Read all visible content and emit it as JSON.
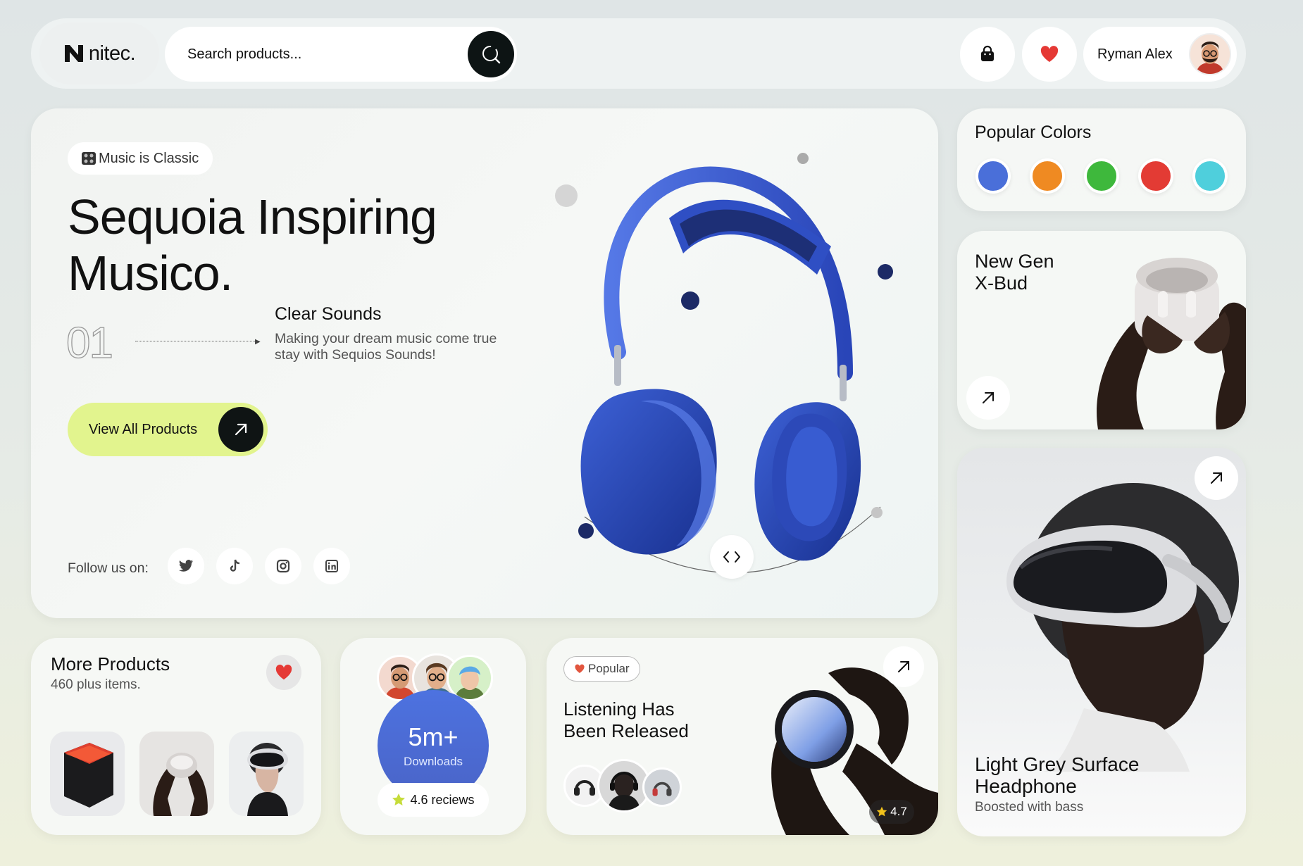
{
  "header": {
    "logo_text": "nitec.",
    "search_placeholder": "Search products...",
    "user_name": "Ryman Alex"
  },
  "hero": {
    "badge": "Music is Classic",
    "title_line1": "Sequoia Inspiring",
    "title_line2": "Musico.",
    "number": "01",
    "feature_title": "Clear Sounds",
    "feature_desc_line1": "Making your dream music come true",
    "feature_desc_line2": "stay with Sequios Sounds!",
    "cta_label": "View All Products",
    "follow_label": "Follow us on:",
    "socials": [
      "twitter-icon",
      "tiktok-icon",
      "instagram-icon",
      "linkedin-icon"
    ]
  },
  "popular_colors": {
    "title": "Popular Colors",
    "colors": [
      "#4a6fd9",
      "#ef8a22",
      "#3eb83c",
      "#e33b34",
      "#4fcfdc"
    ]
  },
  "xbud": {
    "title_line1": "New Gen",
    "title_line2": "X-Bud"
  },
  "vr": {
    "title_line1": "Light Grey Surface",
    "title_line2": "Headphone",
    "subtitle": "Boosted with bass"
  },
  "more_products": {
    "title": "More Products",
    "subtitle": "460 plus items."
  },
  "downloads": {
    "count": "5m+",
    "label": "Downloads",
    "reviews": "4.6 reciews"
  },
  "listening": {
    "badge": "Popular",
    "title_line1": "Listening Has",
    "title_line2": "Been Released",
    "rating": "4.7"
  },
  "colors": {
    "accent_lime": "#e2f48e",
    "dark": "#0f1414",
    "headphone_blue": "#3c5fd0"
  }
}
